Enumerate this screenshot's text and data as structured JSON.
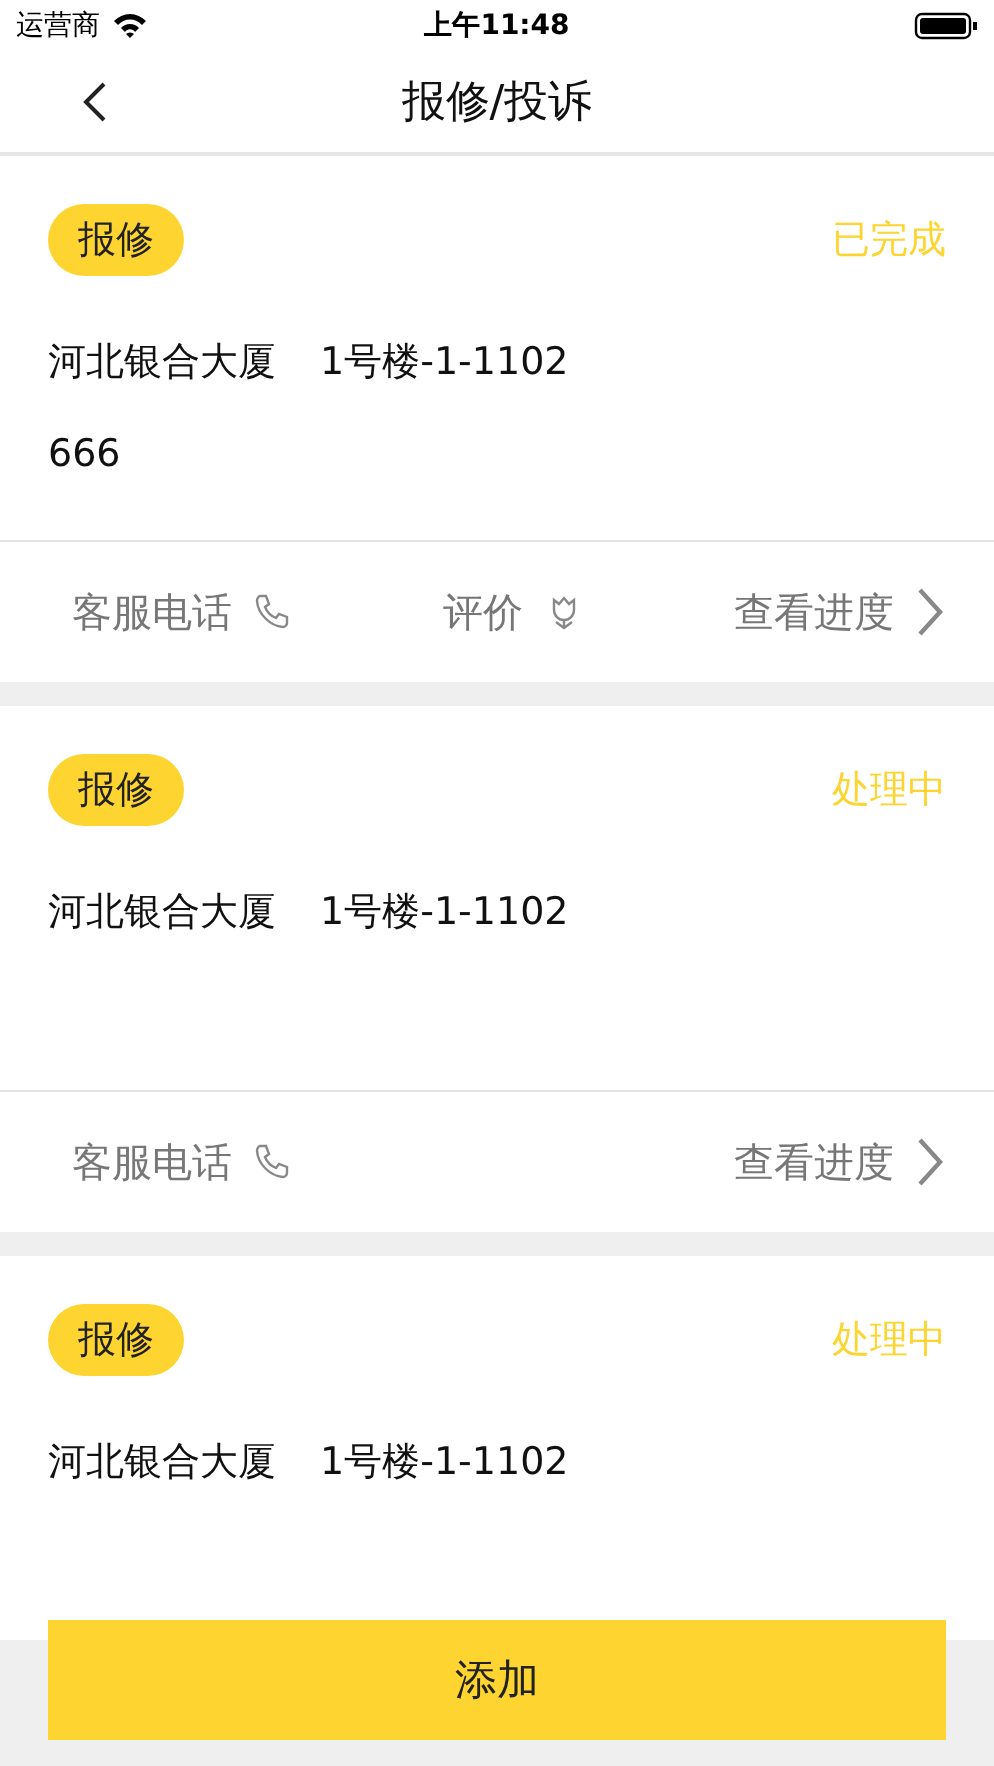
{
  "status_bar": {
    "carrier": "运营商",
    "time": "上午11:48"
  },
  "nav": {
    "title": "报修/投诉"
  },
  "cards": [
    {
      "tag": "报修",
      "status": "已完成",
      "address": "河北银合大厦",
      "unit": "1号楼-1-1102",
      "note": "666",
      "actions": [
        {
          "kind": "phone",
          "label": "客服电话"
        },
        {
          "kind": "rate",
          "label": "评价"
        },
        {
          "kind": "progress",
          "label": "查看进度"
        }
      ]
    },
    {
      "tag": "报修",
      "status": "处理中",
      "address": "河北银合大厦",
      "unit": "1号楼-1-1102",
      "actions": [
        {
          "kind": "phone",
          "label": "客服电话"
        },
        {
          "kind": "progress",
          "label": "查看进度"
        }
      ]
    },
    {
      "tag": "报修",
      "status": "处理中",
      "address": "河北银合大厦",
      "unit": "1号楼-1-1102"
    }
  ],
  "add_button": "添加"
}
